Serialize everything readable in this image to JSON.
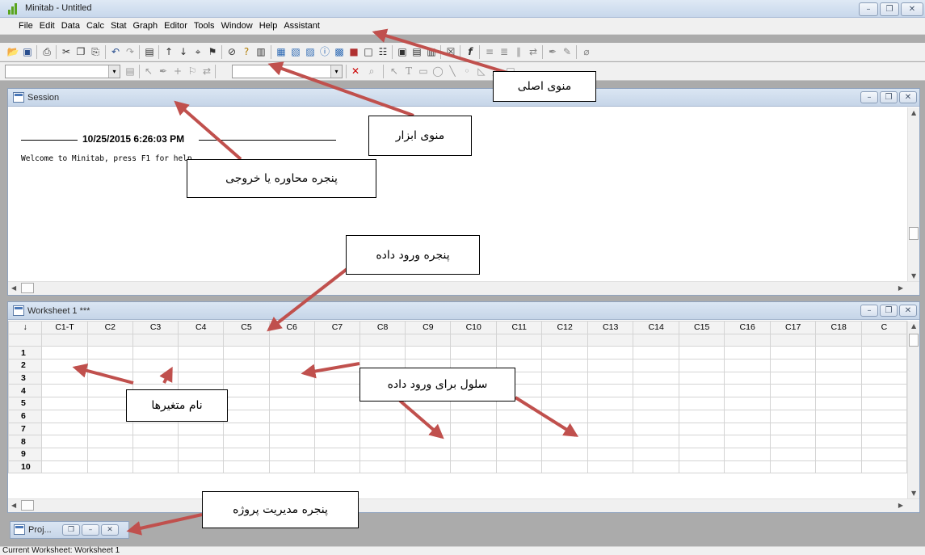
{
  "window": {
    "title": "Minitab - Untitled",
    "buttons": [
      "–",
      "❐",
      "✕"
    ]
  },
  "menu": [
    "File",
    "Edit",
    "Data",
    "Calc",
    "Stat",
    "Graph",
    "Editor",
    "Tools",
    "Window",
    "Help",
    "Assistant"
  ],
  "session": {
    "title": "Session",
    "date": "10/25/2015 6:26:03 PM",
    "welcome": "Welcome to Minitab, press F1 for help."
  },
  "worksheet": {
    "title": "Worksheet 1 ***",
    "corner": "↓",
    "columns": [
      "C1-T",
      "C2",
      "C3",
      "C4",
      "C5",
      "C6",
      "C7",
      "C8",
      "C9",
      "C10",
      "C11",
      "C12",
      "C13",
      "C14",
      "C15",
      "C16",
      "C17",
      "C18",
      "C"
    ],
    "rows": [
      "1",
      "2",
      "3",
      "4",
      "5",
      "6",
      "7",
      "8",
      "9",
      "10"
    ]
  },
  "project": {
    "title": "Proj..."
  },
  "status": {
    "text": "Current Worksheet: Worksheet 1"
  },
  "annotations": {
    "main_menu": "منوی اصلی",
    "toolbar": "منوی ابزار",
    "session_window": "پنجره محاوره یا خروجی",
    "data_window": "پنجره ورود داده",
    "variable_names": "نام متغیرها",
    "data_cells": "سلول برای ورود داده",
    "project_manager": "پنجره مدیریت پروژه"
  }
}
